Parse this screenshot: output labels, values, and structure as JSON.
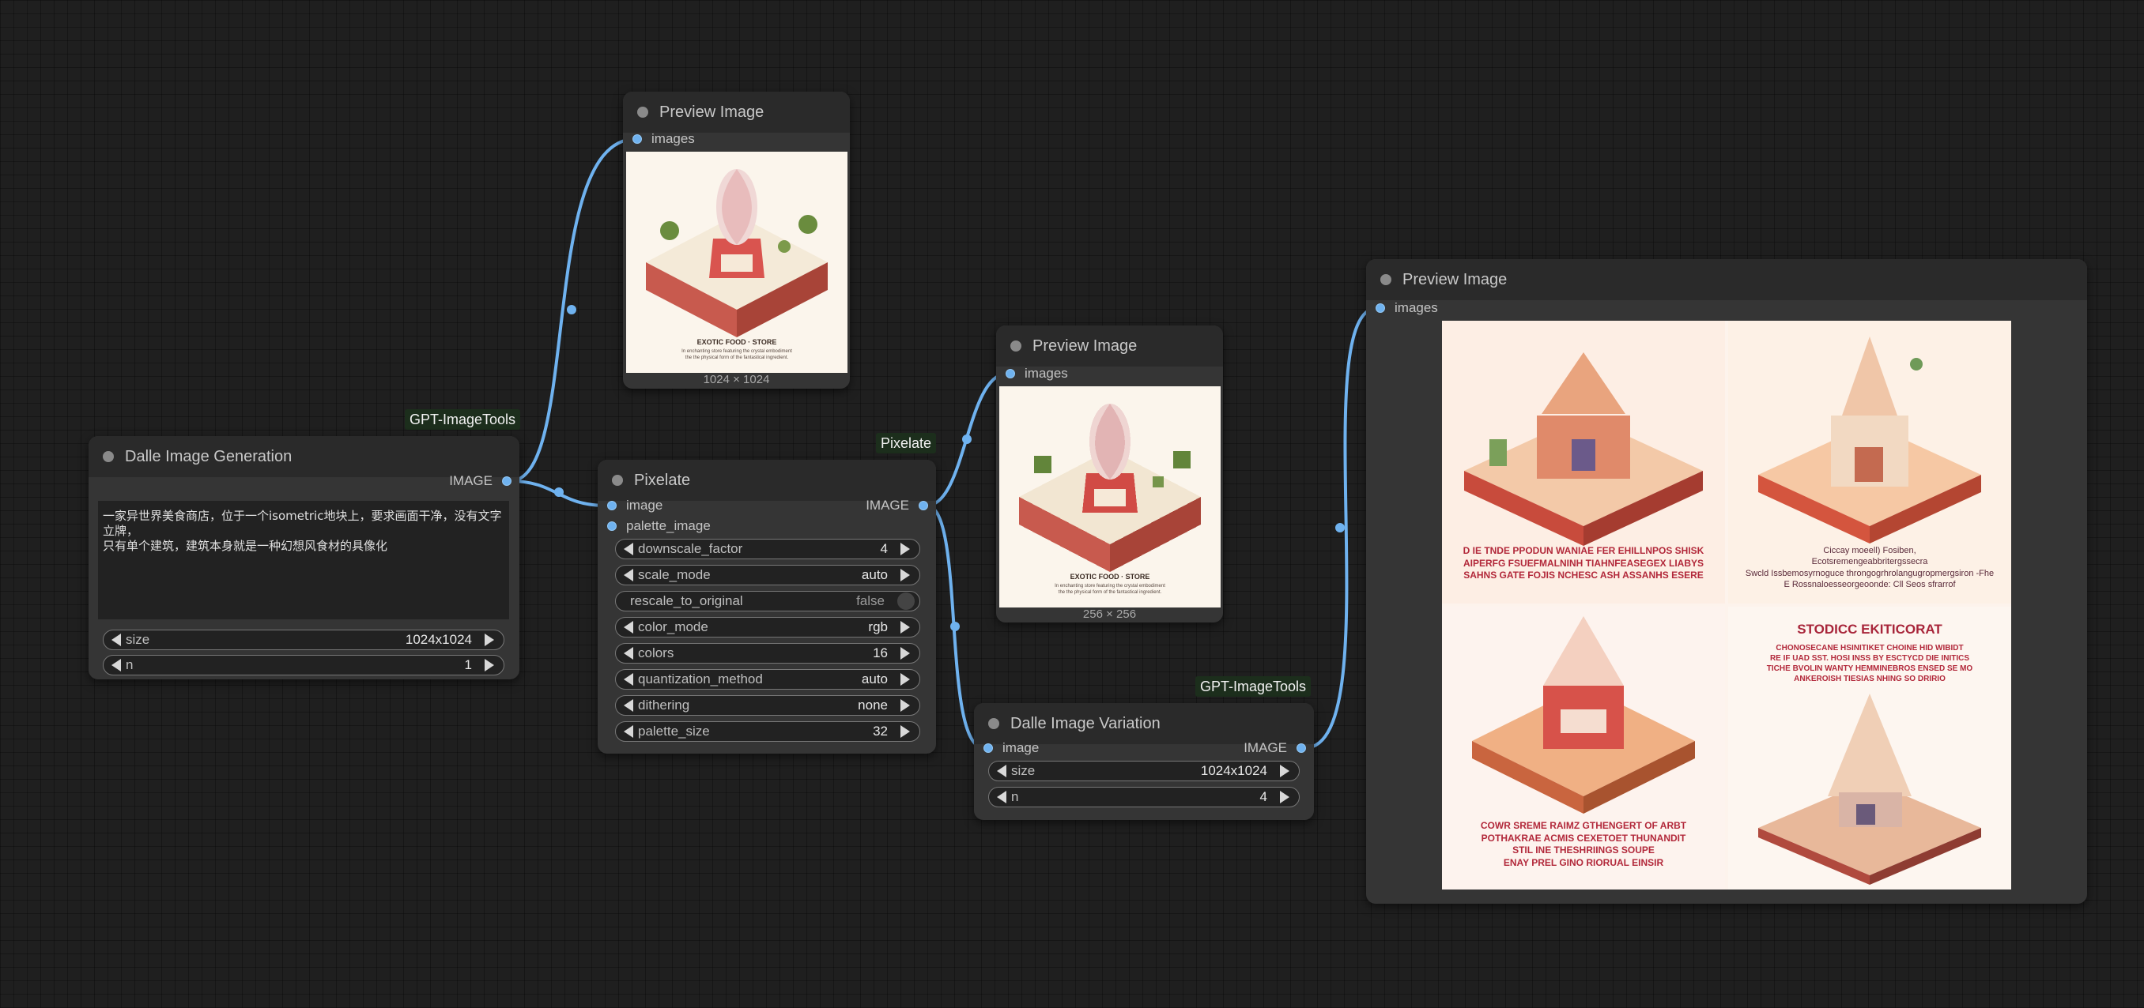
{
  "nodes": {
    "dalle_gen": {
      "title": "Dalle Image Generation",
      "tag": "GPT-ImageTools",
      "output_label": "IMAGE",
      "prompt_line1": "一家异世界美食商店，位于一个isometric地块上，要求画面干净，没有文字立牌，",
      "prompt_line2": "只有单个建筑，建筑本身就是一种幻想风食材的具像化",
      "widgets": [
        {
          "name": "size",
          "value": "1024x1024"
        },
        {
          "name": "n",
          "value": "1"
        }
      ]
    },
    "preview1": {
      "title": "Preview Image",
      "input_label": "images",
      "size_caption": "1024 × 1024",
      "image_caption_title": "EXOTIC FOOD · STORE",
      "image_caption_sub1": "In enchanting store featuring the crystal embodiment",
      "image_caption_sub2": "the the physical form of the fantastical ingredient."
    },
    "pixelate": {
      "title": "Pixelate",
      "tag": "Pixelate",
      "inputs": [
        "image",
        "palette_image"
      ],
      "output_label": "IMAGE",
      "widgets": [
        {
          "name": "downscale_factor",
          "value": "4"
        },
        {
          "name": "scale_mode",
          "value": "auto"
        },
        {
          "name": "rescale_to_original",
          "value": "false"
        },
        {
          "name": "color_mode",
          "value": "rgb"
        },
        {
          "name": "colors",
          "value": "16"
        },
        {
          "name": "quantization_method",
          "value": "auto"
        },
        {
          "name": "dithering",
          "value": "none"
        },
        {
          "name": "palette_size",
          "value": "32"
        }
      ]
    },
    "preview2": {
      "title": "Preview Image",
      "input_label": "images",
      "size_caption": "256 × 256",
      "image_caption_title": "EXOTIC FOOD · STORE",
      "image_caption_sub1": "In enchanting store featuring the crystal embodiment",
      "image_caption_sub2": "the the physical form of the fantastical ingredient."
    },
    "variation": {
      "title": "Dalle Image Variation",
      "tag": "GPT-ImageTools",
      "input_label": "image",
      "output_label": "IMAGE",
      "widgets": [
        {
          "name": "size",
          "value": "1024x1024"
        },
        {
          "name": "n",
          "value": "4"
        }
      ]
    },
    "preview3": {
      "title": "Preview Image",
      "input_label": "images",
      "quad1_text": [
        "D IE TNDE PPODUN WANIAE FER EHILLNPOS SHISK",
        "AIPERFG FSUEFMALNINH TIAHNFEASEGEX LIABYS",
        "SAHNS GATE FOJIS NCHESC ASH ASSANHS ESERE"
      ],
      "quad2_text": [
        "Ciccay moeell) Fosiben,",
        "Ecotsremengeabbritergssecra",
        "Swcld Issbemosyrnoguce throngogrhrolangugropmergsiron -Fhe",
        "E Rossnaloesseorgeoonde: Cll Seos sfrarrof"
      ],
      "quad3_text": [
        "COWR SREME RAIMZ GTHENGERT OF ARBT",
        "POTHAKRAE ACMIS CEXETOET THUNANDIT",
        "STIL INE THESHRIINGS SOUPE",
        "ENAY PREL GINO RIORUAL EINSIR"
      ],
      "quad4_title": "STODICC EKITICORAT",
      "quad4_text": [
        "CHONOSECANE HSINITIKET CHOINE HID WIBIDT",
        "RE IF UAD SST. HOSI INSS BY ESCTYCD DIE INITICS",
        "TICHE BVOLIN WANTY HEMMINEBROS ENSED SE MO",
        "ANKEROISH TIESIAS             NHING SO DRIRIO"
      ]
    }
  },
  "colors": {
    "link": "#6fb2ef",
    "node_bg": "#353535",
    "title_bg": "#2a2a2a",
    "canvas_bg": "#1f1f1f"
  }
}
